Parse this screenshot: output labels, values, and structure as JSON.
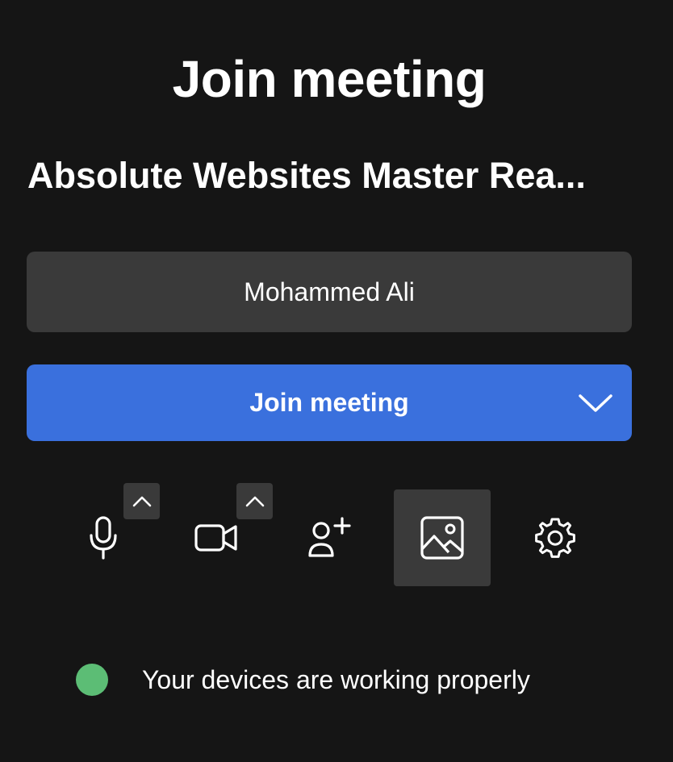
{
  "header": {
    "title": "Join meeting",
    "meeting_name": "Absolute Websites Master Rea..."
  },
  "name_input": {
    "value": "Mohammed Ali"
  },
  "join_button": {
    "label": "Join meeting"
  },
  "controls": [
    {
      "name": "microphone",
      "icon": "microphone-icon",
      "has_options_caret": true
    },
    {
      "name": "camera",
      "icon": "video-camera-icon",
      "has_options_caret": true
    },
    {
      "name": "invite",
      "icon": "add-person-icon",
      "has_options_caret": false
    },
    {
      "name": "background",
      "icon": "image-icon",
      "has_options_caret": false,
      "active": true
    },
    {
      "name": "settings",
      "icon": "gear-icon",
      "has_options_caret": false
    }
  ],
  "status": {
    "text": "Your devices are working properly",
    "color": "#5cbd75"
  },
  "colors": {
    "background": "#151515",
    "field": "#3a3a3a",
    "accent": "#3a70dd"
  }
}
